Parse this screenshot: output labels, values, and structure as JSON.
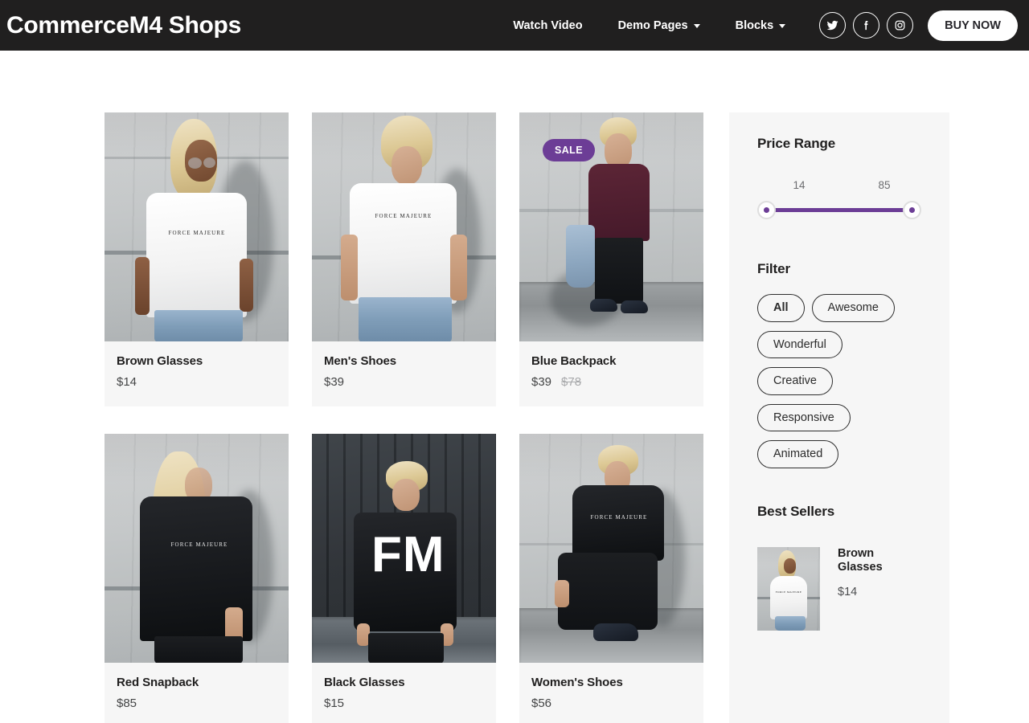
{
  "header": {
    "logo": "CommerceM4 Shops",
    "nav": [
      {
        "label": "Watch Video",
        "has_caret": false
      },
      {
        "label": "Demo Pages",
        "has_caret": true
      },
      {
        "label": "Blocks",
        "has_caret": true
      }
    ],
    "socials": [
      {
        "name": "twitter-icon"
      },
      {
        "name": "facebook-icon"
      },
      {
        "name": "instagram-icon"
      }
    ],
    "buy_now": "BUY NOW",
    "bg_color": "#201f1f",
    "text_color": "#ffffff"
  },
  "products": [
    {
      "title": "Brown Glasses",
      "price": "$14",
      "old_price": "",
      "badge": ""
    },
    {
      "title": "Men's Shoes",
      "price": "$39",
      "old_price": "",
      "badge": ""
    },
    {
      "title": "Blue Backpack",
      "price": "$39",
      "old_price": "$78",
      "badge": "SALE"
    },
    {
      "title": "Red Snapback",
      "price": "$85",
      "old_price": "",
      "badge": ""
    },
    {
      "title": "Black Glasses",
      "price": "$15",
      "old_price": "",
      "badge": ""
    },
    {
      "title": "Women's Shoes",
      "price": "$56",
      "old_price": "",
      "badge": ""
    }
  ],
  "sidebar": {
    "price_range": {
      "heading": "Price Range",
      "min_value": "14",
      "max_value": "85",
      "track_color": "#6c3d96"
    },
    "filter": {
      "heading": "Filter",
      "chips": [
        {
          "label": "All",
          "active": true
        },
        {
          "label": "Awesome",
          "active": false
        },
        {
          "label": "Wonderful",
          "active": false
        },
        {
          "label": "Creative",
          "active": false
        },
        {
          "label": "Responsive",
          "active": false
        },
        {
          "label": "Animated",
          "active": false
        }
      ]
    },
    "best_sellers": {
      "heading": "Best Sellers",
      "items": [
        {
          "title": "Brown Glasses",
          "price": "$14"
        }
      ]
    },
    "bg_color": "#f6f6f6"
  },
  "theme": {
    "accent": "#6c3d96",
    "card_bg": "#f6f6f6",
    "page_bg": "#ffffff"
  }
}
